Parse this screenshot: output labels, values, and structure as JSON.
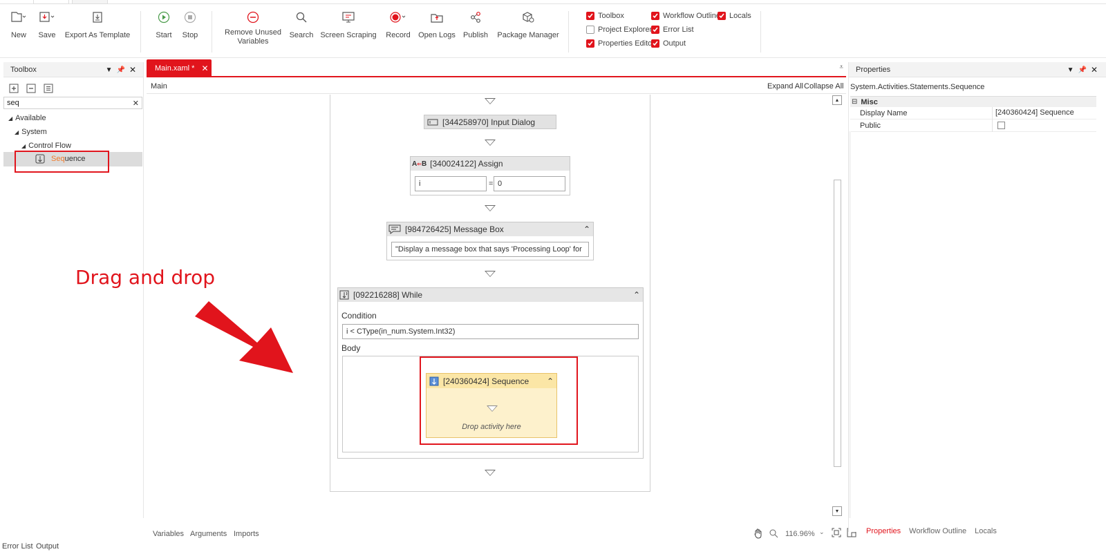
{
  "ribbon": {
    "new": "New",
    "save": "Save",
    "export_template": "Export As Template",
    "start": "Start",
    "stop": "Stop",
    "remove_unused_line1": "Remove Unused",
    "remove_unused_line2": "Variables",
    "search": "Search",
    "screen_scraping": "Screen Scraping",
    "record": "Record",
    "open_logs": "Open Logs",
    "publish": "Publish",
    "package_manager": "Package Manager",
    "toggles": {
      "toolbox": "Toolbox",
      "workflow_outline": "Workflow Outline",
      "locals": "Locals",
      "project_explorer": "Project Explorer",
      "error_list": "Error List",
      "properties_editor": "Properties Editor",
      "output": "Output"
    }
  },
  "toolbox": {
    "title": "Toolbox",
    "search_value": "seq",
    "tree": {
      "available": "Available",
      "system": "System",
      "control_flow": "Control Flow",
      "sequence_match": "Seq",
      "sequence_rest": "uence"
    }
  },
  "document": {
    "tab_label": "Main.xaml *",
    "breadcrumb": "Main",
    "expand_all": "Expand All",
    "collapse_all": "Collapse All"
  },
  "workflow": {
    "input_dialog": "[344258970] Input Dialog",
    "assign": "[340024122] Assign",
    "assign_left": "i",
    "assign_right": "0",
    "assign_eq": "=",
    "message_box": "[984726425] Message Box",
    "message_text": "\"Display a message box that says 'Processing Loop' for",
    "while": "[092216288] While",
    "condition_label": "Condition",
    "condition_value": "i < CType(in_num.System.Int32)",
    "body_label": "Body",
    "sequence": "[240360424] Sequence",
    "drop_hint": "Drop activity here"
  },
  "annotation": {
    "text": "Drag and drop",
    "color": "#e1141c"
  },
  "canvas_footer": {
    "variables": "Variables",
    "arguments": "Arguments",
    "imports": "Imports",
    "zoom": "116.96%"
  },
  "properties": {
    "title": "Properties",
    "type_name": "System.Activities.Statements.Sequence",
    "category": "Misc",
    "rows": [
      {
        "name": "Display Name",
        "value": "[240360424] Sequence"
      },
      {
        "name": "Public",
        "value": ""
      }
    ],
    "tabs": [
      "Properties",
      "Workflow Outline",
      "Locals"
    ]
  },
  "bottom_tabs": [
    "Error List",
    "Output"
  ],
  "colors": {
    "accent": "#e1141c",
    "sequence_fill": "#fdf1cc",
    "sequence_border": "#e8c36a"
  }
}
